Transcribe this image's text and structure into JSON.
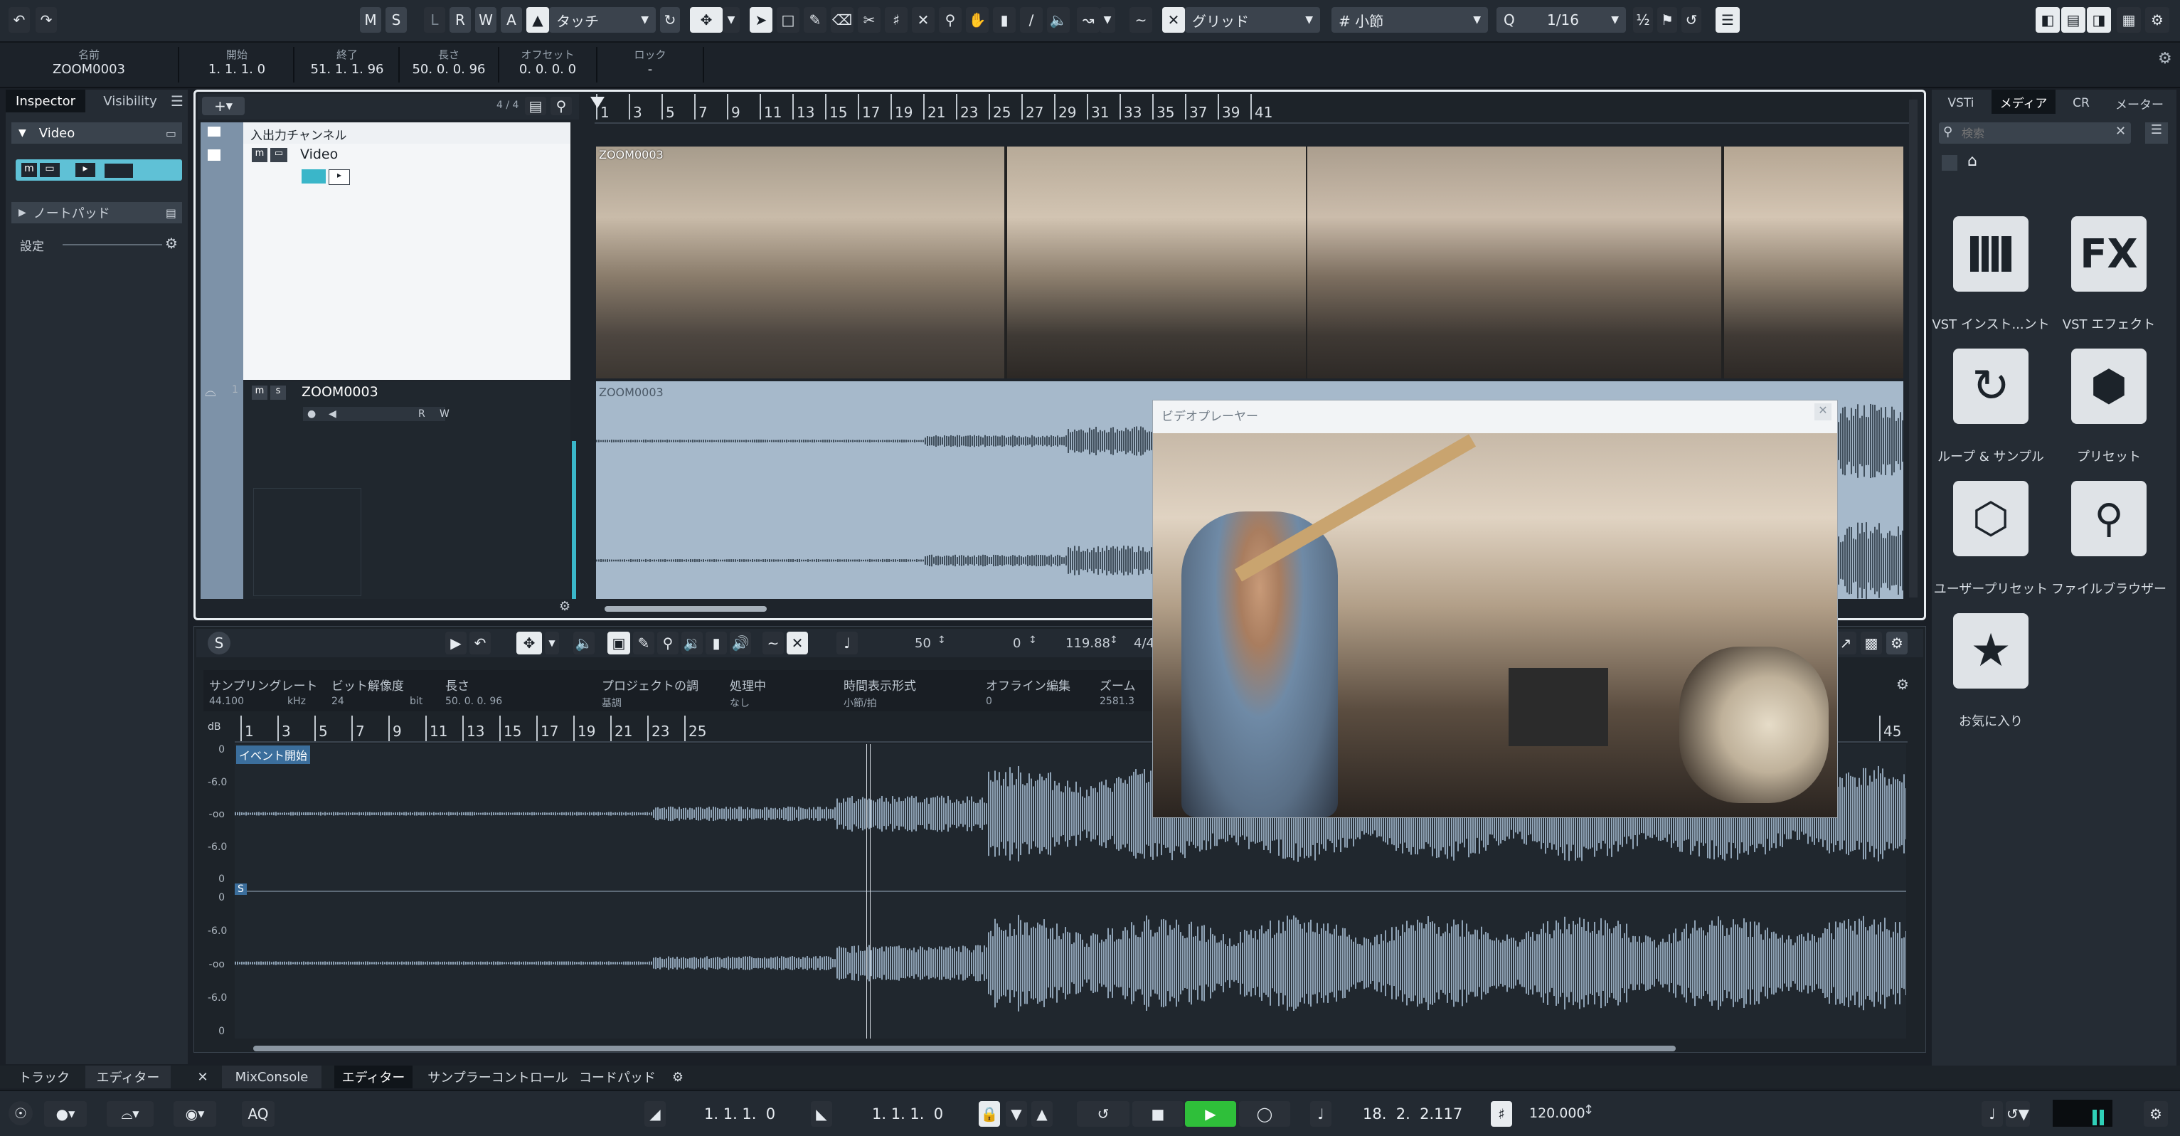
{
  "toolbar": {
    "undo_icon": "undo-icon",
    "redo_icon": "redo-icon",
    "mode_m": "M",
    "mode_s": "S",
    "mode_l": "L",
    "mode_r": "R",
    "mode_w": "W",
    "mode_a": "A",
    "automation_mode": "タッチ",
    "grid_type": "グリッド",
    "grid_snap": "小節",
    "quantize_label": "Q",
    "quantize_value": "1/16"
  },
  "info_line": {
    "name_label": "名前",
    "name_value": "ZOOM0003",
    "start_label": "開始",
    "start_value": "1. 1. 1.  0",
    "end_label": "終了",
    "end_value": "51. 1. 1. 96",
    "length_label": "長さ",
    "length_value": "50. 0. 0. 96",
    "offset_label": "オフセット",
    "offset_value": "0. 0. 0.  0",
    "lock_label": "ロック",
    "lock_value": "-"
  },
  "inspector": {
    "tab_inspector": "Inspector",
    "tab_visibility": "Visibility",
    "track_name": "Video",
    "notepad": "ノートパッド",
    "settings": "設定"
  },
  "tracklist": {
    "count": "4 / 4",
    "io_channel": "入出力チャンネル",
    "video_track": "Video",
    "audio_track": "ZOOM0003",
    "track_number": "1"
  },
  "arranger": {
    "ruler": [
      "1",
      "3",
      "5",
      "7",
      "9",
      "11",
      "13",
      "15",
      "17",
      "19",
      "21",
      "23",
      "25",
      "27",
      "29",
      "31",
      "33",
      "35",
      "37",
      "39",
      "41"
    ],
    "video_event_name": "ZOOM0003",
    "audio_event_name": "ZOOM0003"
  },
  "video_player": {
    "title": "ビデオプレーヤー"
  },
  "sample_editor": {
    "toolbar_value1": "50",
    "toolbar_value2": "0",
    "toolbar_tempo": "119.88",
    "toolbar_sig": "4/4",
    "columns": [
      {
        "header": "サンプリングレート",
        "value": "44.100",
        "unit": "kHz"
      },
      {
        "header": "ビット解像度",
        "value": "24",
        "unit": "bit"
      },
      {
        "header": "長さ",
        "value": "50. 0. 0. 96"
      },
      {
        "header": "プロジェクトの調",
        "value": "基調"
      },
      {
        "header": "処理中",
        "value": "なし"
      },
      {
        "header": "時間表示形式",
        "value": "小節/拍"
      },
      {
        "header": "オフライン編集",
        "value": "0"
      },
      {
        "header": "ズーム",
        "value": "2581.3"
      }
    ],
    "ruler": [
      "1",
      "3",
      "5",
      "7",
      "9",
      "11",
      "13",
      "15",
      "17",
      "19",
      "21",
      "23",
      "25",
      "45"
    ],
    "db_label": "dB",
    "db_scale_top": [
      "0",
      "-6.0",
      "-oo",
      "-6.0",
      "0"
    ],
    "db_scale_bottom": [
      "0",
      "-6.0",
      "-oo",
      "-6.0",
      "0"
    ],
    "event_start": "イベント開始",
    "s_marker": "S"
  },
  "media_bay": {
    "tab_vsti": "VSTi",
    "tab_media": "メディア",
    "tab_cr": "CR",
    "tab_meter": "メーター",
    "search_placeholder": "検索",
    "tiles": [
      {
        "label": "VST インスト...ント",
        "icon": "piano-keys-icon"
      },
      {
        "label": "VST エフェクト",
        "icon": "fx-icon"
      },
      {
        "label": "ループ & サンプル",
        "icon": "loop-icon"
      },
      {
        "label": "プリセット",
        "icon": "hexagons-icon"
      },
      {
        "label": "ユーザープリセット",
        "icon": "user-preset-icon"
      },
      {
        "label": "ファイルブラウザー",
        "icon": "file-browser-icon"
      },
      {
        "label": "お気に入り",
        "icon": "star-icon"
      }
    ]
  },
  "bottom_tabs": {
    "tracks": "トラック",
    "editor_left": "エディター",
    "mixconsole": "MixConsole",
    "editor": "エディター",
    "sampler": "サンプラーコントロール",
    "chord_pads": "コードパッド"
  },
  "transport": {
    "aq": "AQ",
    "left_locator": "1. 1. 1.  0",
    "right_locator": "1. 1. 1.  0",
    "position": "18.  2.  2.117",
    "tempo": "120.000"
  },
  "colors": {
    "accent": "#3ab6c9",
    "play_green": "#2fbf3a",
    "bg": "#1a1f26"
  }
}
